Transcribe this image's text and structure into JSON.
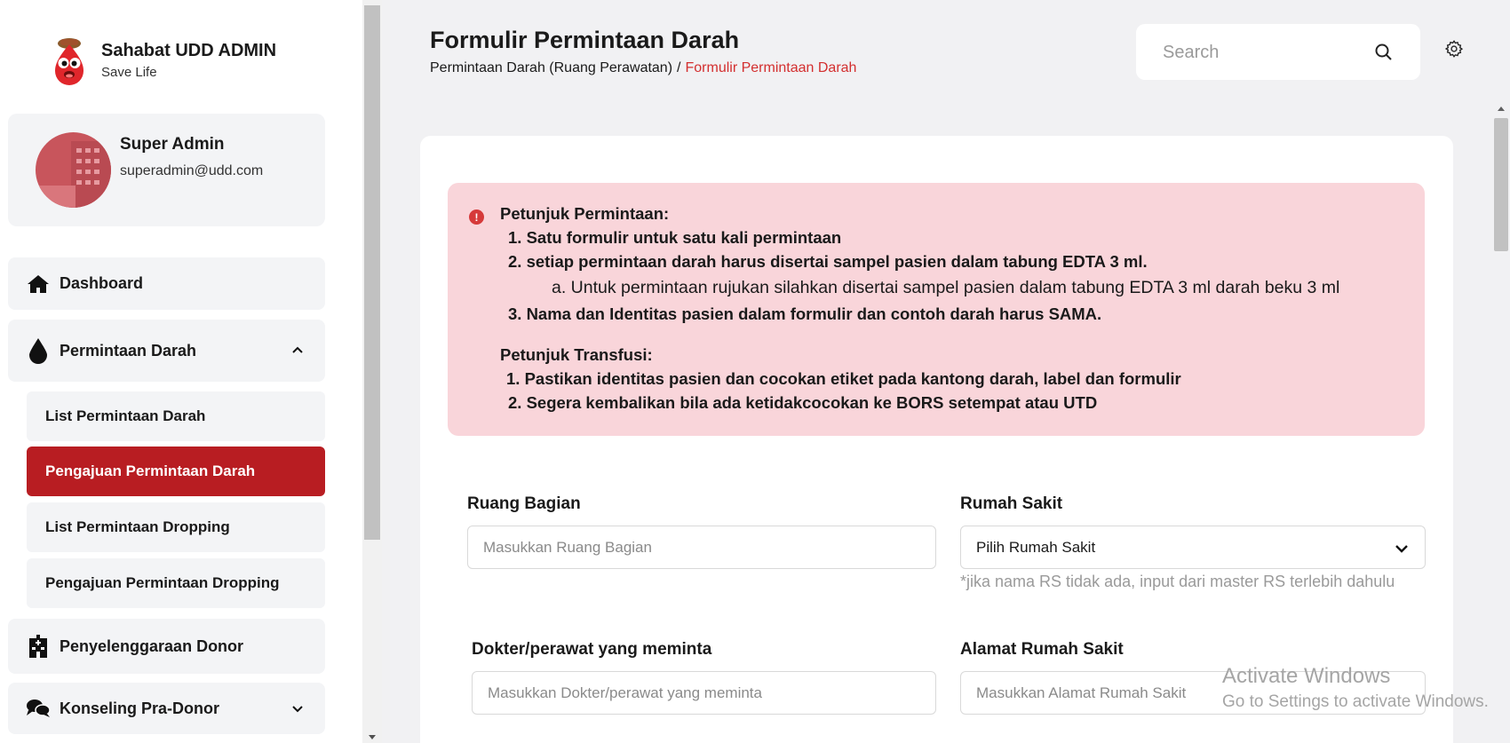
{
  "brand": {
    "title": "Sahabat UDD ADMIN",
    "subtitle": "Save Life"
  },
  "profile": {
    "name": "Super Admin",
    "email": "superadmin@udd.com"
  },
  "sidebar": {
    "items": [
      {
        "label": "Dashboard",
        "icon": "home-icon"
      },
      {
        "label": "Permintaan Darah",
        "icon": "blood-drop-icon",
        "expanded": true
      },
      {
        "label": "Penyelenggaraan Donor",
        "icon": "hospital-icon"
      },
      {
        "label": "Konseling Pra-Donor",
        "icon": "chat-icon",
        "expanded": false
      }
    ],
    "subitems": [
      {
        "label": "List Permintaan Darah"
      },
      {
        "label": "Pengajuan Permintaan Darah",
        "active": true
      },
      {
        "label": "List Permintaan Dropping"
      },
      {
        "label": "Pengajuan Permintaan Dropping"
      }
    ]
  },
  "header": {
    "title": "Formulir Permintaan Darah",
    "breadcrumb": {
      "parent": "Permintaan Darah (Ruang Perawatan)",
      "separator": "/",
      "current": "Formulir Permintaan Darah"
    },
    "search_placeholder": "Search"
  },
  "alert": {
    "lines": [
      "Petunjuk Permintaan:",
      "1. Satu formulir untuk satu kali permintaan",
      "2. setiap permintaan darah harus disertai sampel pasien dalam tabung EDTA 3 ml.",
      "a. Untuk permintaan rujukan silahkan disertai sampel pasien dalam tabung EDTA 3 ml darah beku 3 ml",
      "3. Nama dan Identitas pasien dalam formulir dan contoh darah harus SAMA.",
      "Petunjuk Transfusi:",
      "1. Pastikan identitas pasien dan cocokan etiket pada kantong darah, label dan formulir",
      "2. Segera kembalikan bila ada ketidakcocokan ke BORS setempat atau UTD"
    ]
  },
  "form": {
    "ruang_bagian": {
      "label": "Ruang Bagian",
      "placeholder": "Masukkan Ruang Bagian"
    },
    "rumah_sakit": {
      "label": "Rumah Sakit",
      "value": "Pilih Rumah Sakit",
      "hint": "*jika nama RS tidak ada, input dari master RS terlebih dahulu"
    },
    "dokter": {
      "label": "Dokter/perawat yang meminta",
      "placeholder": "Masukkan Dokter/perawat yang meminta"
    },
    "alamat": {
      "label": "Alamat Rumah Sakit",
      "placeholder": "Masukkan Alamat Rumah Sakit"
    }
  },
  "watermark": {
    "line1": "Activate Windows",
    "line2": "Go to Settings to activate Windows."
  },
  "colors": {
    "accent": "#b81d22",
    "alert_bg": "#f9d5da",
    "breadcrumb_current": "#d32f2f"
  }
}
